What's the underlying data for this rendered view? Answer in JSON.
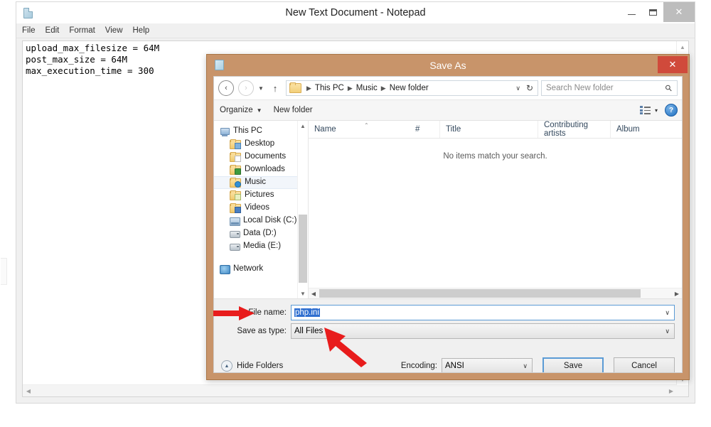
{
  "notepad": {
    "title": "New Text Document - Notepad",
    "icon": "notepad-document-icon",
    "menu": [
      "File",
      "Edit",
      "Format",
      "View",
      "Help"
    ],
    "window_buttons": {
      "minimize": "–",
      "maximize": "□",
      "close": "✕"
    },
    "content": "upload_max_filesize = 64M\npost_max_size = 64M\nmax_execution_time = 300"
  },
  "save_dialog": {
    "title": "Save As",
    "close_label": "✕",
    "title_bar_color": "#c8946a",
    "close_button_color": "#d04a3b",
    "nav": {
      "back": "←",
      "forward": "→",
      "recent_caret": "▾",
      "up": "↑",
      "breadcrumb": [
        "This PC",
        "Music",
        "New folder"
      ],
      "breadcrumb_caret": "∨",
      "refresh": "↻"
    },
    "search": {
      "placeholder": "Search New folder",
      "icon": "search-icon"
    },
    "toolbar": {
      "organize": "Organize",
      "organize_caret": "▾",
      "new_folder": "New folder",
      "view_caret": "▾",
      "help": "?"
    },
    "sidebar": [
      {
        "label": "This PC",
        "icon": "computer-icon",
        "indent": false,
        "selected": false
      },
      {
        "label": "Desktop",
        "icon": "desktop-folder-icon",
        "indent": true,
        "selected": false
      },
      {
        "label": "Documents",
        "icon": "documents-folder-icon",
        "indent": true,
        "selected": false
      },
      {
        "label": "Downloads",
        "icon": "downloads-folder-icon",
        "indent": true,
        "selected": false
      },
      {
        "label": "Music",
        "icon": "music-folder-icon",
        "indent": true,
        "selected": true
      },
      {
        "label": "Pictures",
        "icon": "pictures-folder-icon",
        "indent": true,
        "selected": false
      },
      {
        "label": "Videos",
        "icon": "videos-folder-icon",
        "indent": true,
        "selected": false
      },
      {
        "label": "Local Disk (C:)",
        "icon": "hard-drive-icon",
        "indent": true,
        "selected": false
      },
      {
        "label": "Data (D:)",
        "icon": "drive-icon",
        "indent": true,
        "selected": false
      },
      {
        "label": "Media (E:)",
        "icon": "drive-icon",
        "indent": true,
        "selected": false
      },
      {
        "label": "Network",
        "icon": "network-icon",
        "indent": false,
        "selected": false
      }
    ],
    "file_list": {
      "columns": [
        "Name",
        "#",
        "Title",
        "Contributing artists",
        "Album"
      ],
      "sort_indicator": "⌃",
      "empty_message": "No items match your search.",
      "rows": []
    },
    "form": {
      "file_name_label": "File name:",
      "file_name_value": "php.ini",
      "file_name_selected": true,
      "save_as_type_label": "Save as type:",
      "save_as_type_value": "All Files",
      "caret": "∨"
    },
    "actions": {
      "hide_folders": "Hide Folders",
      "hide_folders_caret": "▲",
      "encoding_label": "Encoding:",
      "encoding_value": "ANSI",
      "save": "Save",
      "cancel": "Cancel"
    },
    "annotations": [
      {
        "name": "arrow-to-file-name",
        "color": "#e81c1c",
        "direction": "right"
      },
      {
        "name": "arrow-to-save-as-type",
        "color": "#e81c1c",
        "direction": "up-left"
      }
    ]
  }
}
